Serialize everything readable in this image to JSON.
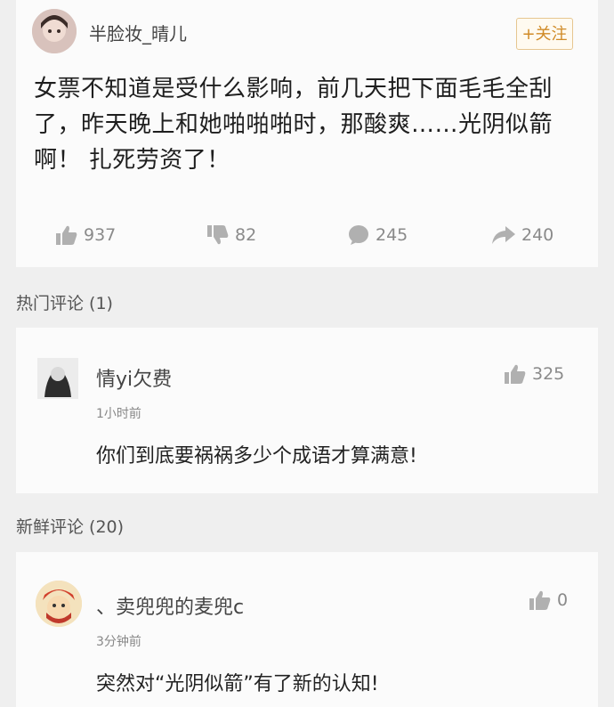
{
  "post": {
    "username": "半脸妆_晴儿",
    "follow_label": "+关注",
    "text": "女票不知道是受什么影响，前几天把下面毛毛全刮了，昨天晚上和她啪啪啪时，那酸爽……光阴似箭啊！ 扎死劳资了！",
    "actions": {
      "likes": "937",
      "dislikes": "82",
      "comments": "245",
      "shares": "240"
    }
  },
  "hot_section": {
    "label": "热门评论 (1)"
  },
  "hot_comment": {
    "username": "情yi欠费",
    "time": "1小时前",
    "text": "你们到底要祸祸多少个成语才算满意!",
    "likes": "325"
  },
  "fresh_section": {
    "label": "新鲜评论 (20)"
  },
  "fresh_comment": {
    "username": "、卖兜兜的麦兜c",
    "time": "3分钟前",
    "text": "突然对“光阴似箭”有了新的认知!",
    "likes": "0"
  },
  "colors": {
    "background": "#efefef",
    "card": "#fbfbfb",
    "accent": "#d08a26",
    "muted": "#8a8a8a"
  }
}
